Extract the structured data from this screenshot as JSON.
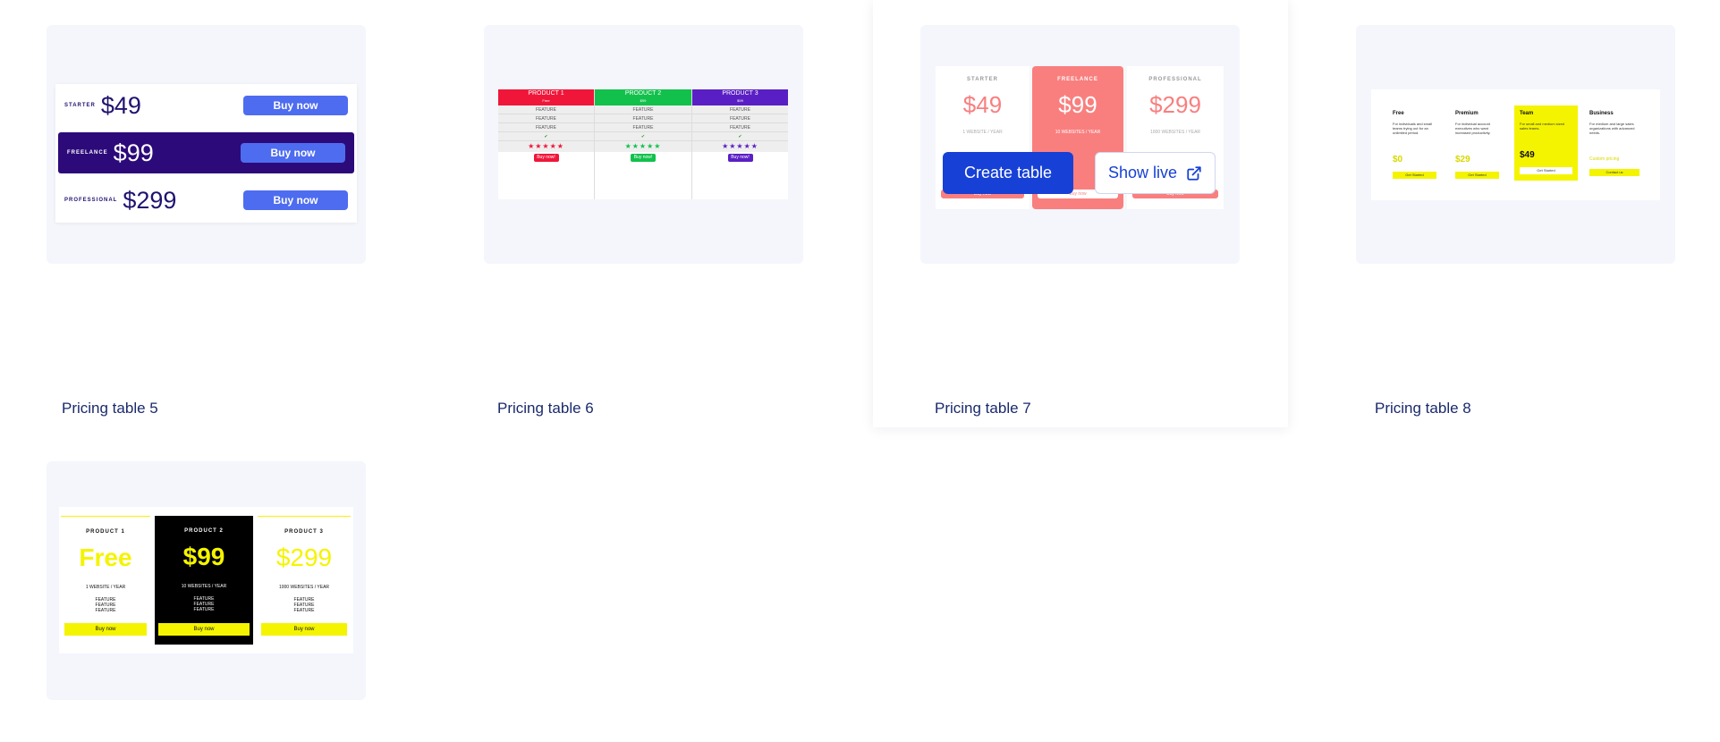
{
  "cards": [
    {
      "title": "Pricing table 5",
      "preview": {
        "rows": [
          {
            "label": "STARTER",
            "price": "$49",
            "button": "Buy now"
          },
          {
            "label": "FREELANCE",
            "price": "$99",
            "button": "Buy now"
          },
          {
            "label": "PROFESSIONAL",
            "price": "$299",
            "button": "Buy now"
          }
        ]
      }
    },
    {
      "title": "Pricing table 6",
      "preview": {
        "columns": [
          {
            "name": "PRODUCT 1",
            "price": "Free",
            "color": "#f0163a",
            "features": [
              "FEATURE",
              "FEATURE",
              "FEATURE"
            ],
            "check": "✔",
            "stars": "★★★★★",
            "button": "Buy now!"
          },
          {
            "name": "PRODUCT 2",
            "price": "$99",
            "color": "#12c14c",
            "features": [
              "FEATURE",
              "FEATURE",
              "FEATURE"
            ],
            "check": "✔",
            "stars": "★★★★★",
            "button": "Buy now!"
          },
          {
            "name": "PRODUCT 3",
            "price": "$99",
            "color": "#5a1fc4",
            "features": [
              "FEATURE",
              "FEATURE",
              "FEATURE"
            ],
            "check": "✔",
            "stars": "★★★★★",
            "button": "Buy now!"
          }
        ]
      }
    },
    {
      "title": "Pricing table 7",
      "preview": {
        "columns": [
          {
            "label": "STARTER",
            "price": "$49",
            "sub": "1 WEBSITE / YEAR",
            "button": "Buy now"
          },
          {
            "label": "FREELANCE",
            "price": "$99",
            "sub": "10 WEBSITES / YEAR",
            "button": "Buy now"
          },
          {
            "label": "PROFESSIONAL",
            "price": "$299",
            "sub": "1000 WEBSITES / YEAR",
            "button": "Buy now"
          }
        ]
      },
      "actions": {
        "create": "Create table",
        "live": "Show live"
      }
    },
    {
      "title": "Pricing table 8",
      "preview": {
        "columns": [
          {
            "name": "Free",
            "desc": "For individuals and small teams trying out for an unlimited period.",
            "price": "$0",
            "button": "Get Started"
          },
          {
            "name": "Premium",
            "desc": "For individual account executives who want increased productivity.",
            "price": "$29",
            "button": "Get Started"
          },
          {
            "name": "Team",
            "desc": "For small and medium sized sales teams.",
            "price": "$49",
            "button": "Get Started"
          },
          {
            "name": "Business",
            "desc": "For medium and large sales organizations with advanced needs.",
            "price": "Custom pricing",
            "button": "Contact us"
          }
        ]
      }
    },
    {
      "title": "",
      "preview": {
        "columns": [
          {
            "label": "PRODUCT 1",
            "price": "Free",
            "sub": "1 WEBSITE / YEAR",
            "features": [
              "FEATURE",
              "FEATURE",
              "FEATURE"
            ],
            "button": "Buy now"
          },
          {
            "label": "PRODUCT 2",
            "price": "$99",
            "sub": "10 WEBSITES / YEAR",
            "features": [
              "FEATURE",
              "FEATURE",
              "FEATURE"
            ],
            "button": "Buy now"
          },
          {
            "label": "PRODUCT 3",
            "price": "$299",
            "sub": "1000 WEBSITES / YEAR",
            "features": [
              "FEATURE",
              "FEATURE",
              "FEATURE"
            ],
            "button": "Buy now"
          }
        ]
      }
    }
  ],
  "colors": {
    "title": "#1a2a6c",
    "thumb_bg": "#f4f6fc",
    "create_button": "#1740d6",
    "t5_highlight": "#2c0a7a",
    "t7_accent": "#f97f7f",
    "t8_highlight": "#f4f400"
  },
  "icons": {
    "show_live": "external-link-icon"
  }
}
